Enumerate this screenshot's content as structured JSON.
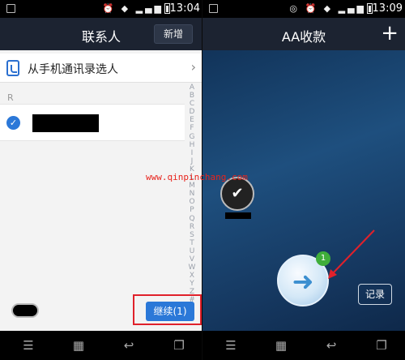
{
  "left_screen": {
    "status": {
      "time": "13:04"
    },
    "header": {
      "title": "联系人",
      "new_button": "新增"
    },
    "pick_from_phone": "从手机通讯录选人",
    "section_letter": "R",
    "contact": {
      "selected": true
    },
    "index_letters": [
      "A",
      "B",
      "C",
      "D",
      "E",
      "F",
      "G",
      "H",
      "I",
      "J",
      "K",
      "L",
      "M",
      "N",
      "O",
      "P",
      "Q",
      "R",
      "S",
      "T",
      "U",
      "V",
      "W",
      "X",
      "Y",
      "Z",
      "#"
    ],
    "continue_button": "继续(1)"
  },
  "right_screen": {
    "status": {
      "time": "13:09"
    },
    "header": {
      "title": "AA收款",
      "add_button": "+"
    },
    "go_badge": "1",
    "record_button": "记录"
  },
  "watermark": "www.qinpinchang.com",
  "colors": {
    "accent": "#2b78d8",
    "highlight": "#e0212b",
    "badge": "#3fae3a"
  }
}
